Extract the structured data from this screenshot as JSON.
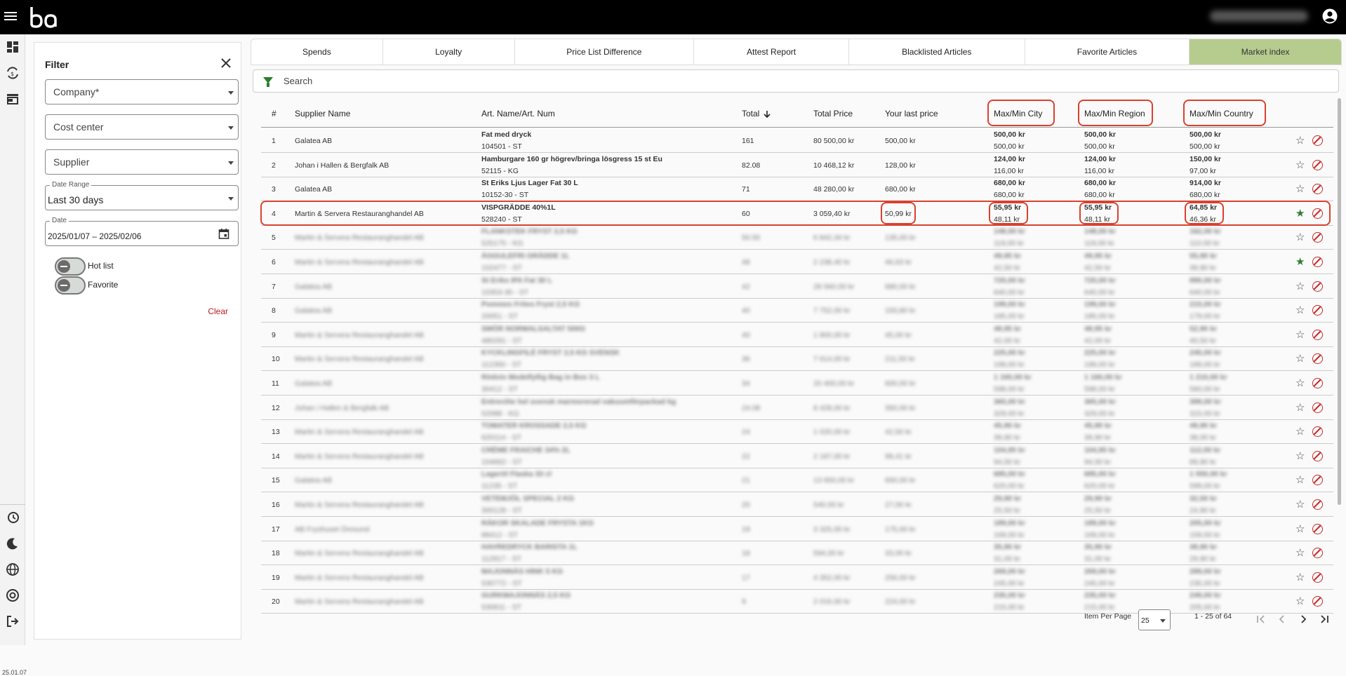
{
  "filter": {
    "title": "Filter",
    "company_label": "Company*",
    "cost_center_label": "Cost center",
    "supplier_label": "Supplier",
    "date_range_legend": "Date Range",
    "date_range_value": "Last 30 days",
    "date_legend": "Date",
    "date_value": "2025/01/07 – 2025/02/06",
    "hot_list_label": "Hot list",
    "favorite_label": "Favorite",
    "clear_label": "Clear"
  },
  "version": "25.01.07",
  "tabs": [
    {
      "label": "Spends"
    },
    {
      "label": "Loyalty"
    },
    {
      "label": "Price List Difference"
    },
    {
      "label": "Attest Report"
    },
    {
      "label": "Blacklisted Articles"
    },
    {
      "label": "Favorite Articles"
    },
    {
      "label": "Market index"
    }
  ],
  "search": {
    "placeholder": "Search"
  },
  "columns": {
    "num": "#",
    "supplier": "Supplier Name",
    "article": "Art. Name/Art. Num",
    "total": "Total",
    "total_price": "Total Price",
    "last_price": "Your last price",
    "city": "Max/Min City",
    "region": "Max/Min Region",
    "country": "Max/Min Country"
  },
  "rows": [
    {
      "n": "1",
      "supplier": "Galatea AB",
      "art": "Fat med dryck",
      "artno": "104501 - ST",
      "total": "161",
      "price": "80 500,00 kr",
      "last": "500,00 kr",
      "cmax": "500,00 kr",
      "cmin": "500,00 kr",
      "rmax": "500,00 kr",
      "rmin": "500,00 kr",
      "kmax": "500,00 kr",
      "kmin": "500,00 kr",
      "fav": false
    },
    {
      "n": "2",
      "supplier": "Johan i Hallen & Bergfalk AB",
      "art": "Hamburgare 160 gr högrev/bringa lösgress 15 st Eu",
      "artno": "52115 - KG",
      "total": "82.08",
      "price": "10 468,12 kr",
      "last": "128,00 kr",
      "cmax": "124,00 kr",
      "cmin": "116,00 kr",
      "rmax": "124,00 kr",
      "rmin": "116,00 kr",
      "kmax": "150,00 kr",
      "kmin": "97,00 kr",
      "fav": false
    },
    {
      "n": "3",
      "supplier": "Galatea AB",
      "art": "St Eriks Ljus Lager Fat 30 L",
      "artno": "10152-30 - ST",
      "total": "71",
      "price": "48 280,00 kr",
      "last": "680,00 kr",
      "cmax": "680,00 kr",
      "cmin": "680,00 kr",
      "rmax": "680,00 kr",
      "rmin": "680,00 kr",
      "kmax": "914,00 kr",
      "kmin": "680,00 kr",
      "fav": false
    },
    {
      "n": "4",
      "supplier": "Martin & Servera Restauranghandel AB",
      "art": "VISPGRÄDDE 40%1L",
      "artno": "528240 - ST",
      "total": "60",
      "price": "3 059,40 kr",
      "last": "50,99 kr",
      "cmax": "55,95 kr",
      "cmin": "48,11 kr",
      "rmax": "55,95 kr",
      "rmin": "48,11 kr",
      "kmax": "64,85 kr",
      "kmin": "46,36 kr",
      "fav": true
    },
    {
      "n": "5",
      "supplier": "Martin & Servera Restauranghandel AB",
      "art": "FLANKSTEK FRYST 2,5 KG",
      "artno": "525175 - KG",
      "total": "50.55",
      "price": "6 842,34 kr",
      "last": "135,00 kr",
      "cmax": "148,00 kr",
      "cmin": "119,00 kr",
      "rmax": "148,00 kr",
      "rmin": "119,00 kr",
      "kmax": "162,00 kr",
      "kmin": "110,00 kr",
      "fav": false,
      "blur": true
    },
    {
      "n": "6",
      "supplier": "Martin & Servera Restauranghandel AB",
      "art": "ÄGGULEFRI GRÄDDE 1L",
      "artno": "102477 - ST",
      "total": "48",
      "price": "2 238,40 kr",
      "last": "46,63 kr",
      "cmax": "49,95 kr",
      "cmin": "42,50 kr",
      "rmax": "49,95 kr",
      "rmin": "42,50 kr",
      "kmax": "55,90 kr",
      "kmin": "39,90 kr",
      "fav": true,
      "blur": true
    },
    {
      "n": "7",
      "supplier": "Galatea AB",
      "art": "St Eriks IPA Fat 30 L",
      "artno": "10353-30 - ST",
      "total": "42",
      "price": "28 560,00 kr",
      "last": "680,00 kr",
      "cmax": "720,00 kr",
      "cmin": "640,00 kr",
      "rmax": "720,00 kr",
      "rmin": "640,00 kr",
      "kmax": "890,00 kr",
      "kmin": "640,00 kr",
      "fav": false,
      "blur": true
    },
    {
      "n": "8",
      "supplier": "Galatea AB",
      "art": "Pommes Frites Fryst 2,5 KG",
      "artno": "20051 - ST",
      "total": "40",
      "price": "7 752,00 kr",
      "last": "193,80 kr",
      "cmax": "199,00 kr",
      "cmin": "185,00 kr",
      "rmax": "199,00 kr",
      "rmin": "185,00 kr",
      "kmax": "215,00 kr",
      "kmin": "179,00 kr",
      "fav": false,
      "blur": true
    },
    {
      "n": "9",
      "supplier": "Martin & Servera Restauranghandel AB",
      "art": "SMÖR NORMALSALTAT 500G",
      "artno": "480291 - ST",
      "total": "40",
      "price": "1 800,00 kr",
      "last": "45,00 kr",
      "cmax": "48,95 kr",
      "cmin": "42,00 kr",
      "rmax": "48,95 kr",
      "rmin": "42,00 kr",
      "kmax": "52,90 kr",
      "kmin": "40,50 kr",
      "fav": false,
      "blur": true
    },
    {
      "n": "10",
      "supplier": "Martin & Servera Restauranghandel AB",
      "art": "KYCKLINGFILÉ FRYST 2,5 KG SVENSK",
      "artno": "112350 - ST",
      "total": "36",
      "price": "7 614,00 kr",
      "last": "211,50 kr",
      "cmax": "225,00 kr",
      "cmin": "199,00 kr",
      "rmax": "225,00 kr",
      "rmin": "199,00 kr",
      "kmax": "245,00 kr",
      "kmin": "189,00 kr",
      "fav": false,
      "blur": true
    },
    {
      "n": "11",
      "supplier": "Galatea AB",
      "art": "Rödvin Medelfyllig Bag in Box 3 L",
      "artno": "30412 - ST",
      "total": "34",
      "price": "20 400,00 kr",
      "last": "600,00 kr",
      "cmax": "1 160,00 kr",
      "cmin": "598,00 kr",
      "rmax": "1 160,00 kr",
      "rmin": "598,00 kr",
      "kmax": "1 210,00 kr",
      "kmin": "560,00 kr",
      "fav": false,
      "blur": true
    },
    {
      "n": "12",
      "supplier": "Johan i Hallen & Bergfalk AB",
      "art": "Entrecôte hel svensk marmorerad vakuumförpackad kg",
      "artno": "52088 - KG",
      "total": "24.08",
      "price": "8 428,00 kr",
      "last": "350,00 kr",
      "cmax": "365,00 kr",
      "cmin": "329,00 kr",
      "rmax": "365,00 kr",
      "rmin": "329,00 kr",
      "kmax": "399,00 kr",
      "kmin": "315,00 kr",
      "fav": false,
      "blur": true
    },
    {
      "n": "13",
      "supplier": "Martin & Servera Restauranghandel AB",
      "art": "TOMATER KROSSADE 2,5 KG",
      "artno": "620114 - ST",
      "total": "24",
      "price": "1 020,00 kr",
      "last": "42,50 kr",
      "cmax": "45,90 kr",
      "cmin": "39,90 kr",
      "rmax": "45,90 kr",
      "rmin": "39,90 kr",
      "kmax": "49,90 kr",
      "kmin": "38,00 kr",
      "fav": false,
      "blur": true
    },
    {
      "n": "14",
      "supplier": "Martin & Servera Restauranghandel AB",
      "art": "CRÈME FRAICHE 34% 2L",
      "artno": "104662 - ST",
      "total": "22",
      "price": "2 187,00 kr",
      "last": "99,41 kr",
      "cmax": "104,95 kr",
      "cmin": "94,50 kr",
      "rmax": "104,95 kr",
      "rmin": "94,50 kr",
      "kmax": "112,00 kr",
      "kmin": "89,90 kr",
      "fav": false,
      "blur": true
    },
    {
      "n": "15",
      "supplier": "Galatea AB",
      "art": "Lageröl Flaska 33 cl",
      "artno": "11235 - ST",
      "total": "21",
      "price": "13 650,00 kr",
      "last": "650,00 kr",
      "cmax": "685,00 kr",
      "cmin": "620,00 kr",
      "rmax": "685,00 kr",
      "rmin": "620,00 kr",
      "kmax": "1 050,00 kr",
      "kmin": "599,00 kr",
      "fav": false,
      "blur": true
    },
    {
      "n": "16",
      "supplier": "Martin & Servera Restauranghandel AB",
      "art": "VETEMJÖL SPECIAL 2 KG",
      "artno": "300128 - ST",
      "total": "20",
      "price": "540,00 kr",
      "last": "27,00 kr",
      "cmax": "29,90 kr",
      "cmin": "25,50 kr",
      "rmax": "29,90 kr",
      "rmin": "25,50 kr",
      "kmax": "32,50 kr",
      "kmin": "24,90 kr",
      "fav": false,
      "blur": true
    },
    {
      "n": "17",
      "supplier": "AB Fryshuset Öresund",
      "art": "RÄKOR SKALADE FRYSTA 1KG",
      "artno": "88412 - ST",
      "total": "19",
      "price": "3 325,00 kr",
      "last": "175,00 kr",
      "cmax": "189,00 kr",
      "cmin": "169,00 kr",
      "rmax": "189,00 kr",
      "rmin": "169,00 kr",
      "kmax": "205,00 kr",
      "kmin": "159,00 kr",
      "fav": false,
      "blur": true
    },
    {
      "n": "18",
      "supplier": "Martin & Servera Restauranghandel AB",
      "art": "HAVREDRYCK BARISTA 1L",
      "artno": "112917 - ST",
      "total": "18",
      "price": "594,00 kr",
      "last": "33,00 kr",
      "cmax": "35,90 kr",
      "cmin": "31,00 kr",
      "rmax": "35,90 kr",
      "rmin": "31,00 kr",
      "kmax": "38,90 kr",
      "kmin": "29,90 kr",
      "fav": false,
      "blur": true
    },
    {
      "n": "19",
      "supplier": "Martin & Servera Restauranghandel AB",
      "art": "MAJONNÄS HINK 5 KG",
      "artno": "530772 - ST",
      "total": "17",
      "price": "4 352,00 kr",
      "last": "256,00 kr",
      "cmax": "269,00 kr",
      "cmin": "245,00 kr",
      "rmax": "269,00 kr",
      "rmin": "245,00 kr",
      "kmax": "289,00 kr",
      "kmin": "235,00 kr",
      "fav": false,
      "blur": true
    },
    {
      "n": "20",
      "supplier": "Martin & Servera Restauranghandel AB",
      "art": "GURKMAJONNÄS 2,5 KG",
      "artno": "530811 - ST",
      "total": "9",
      "price": "2 016,00 kr",
      "last": "224,00 kr",
      "cmax": "235,00 kr",
      "cmin": "215,00 kr",
      "rmax": "235,00 kr",
      "rmin": "215,00 kr",
      "kmax": "249,00 kr",
      "kmin": "205,00 kr",
      "fav": false,
      "blur": true
    }
  ],
  "pager": {
    "items_per_page_label": "Item Per Page",
    "items_per_page_value": "25",
    "range": "1 - 25 of 64"
  }
}
